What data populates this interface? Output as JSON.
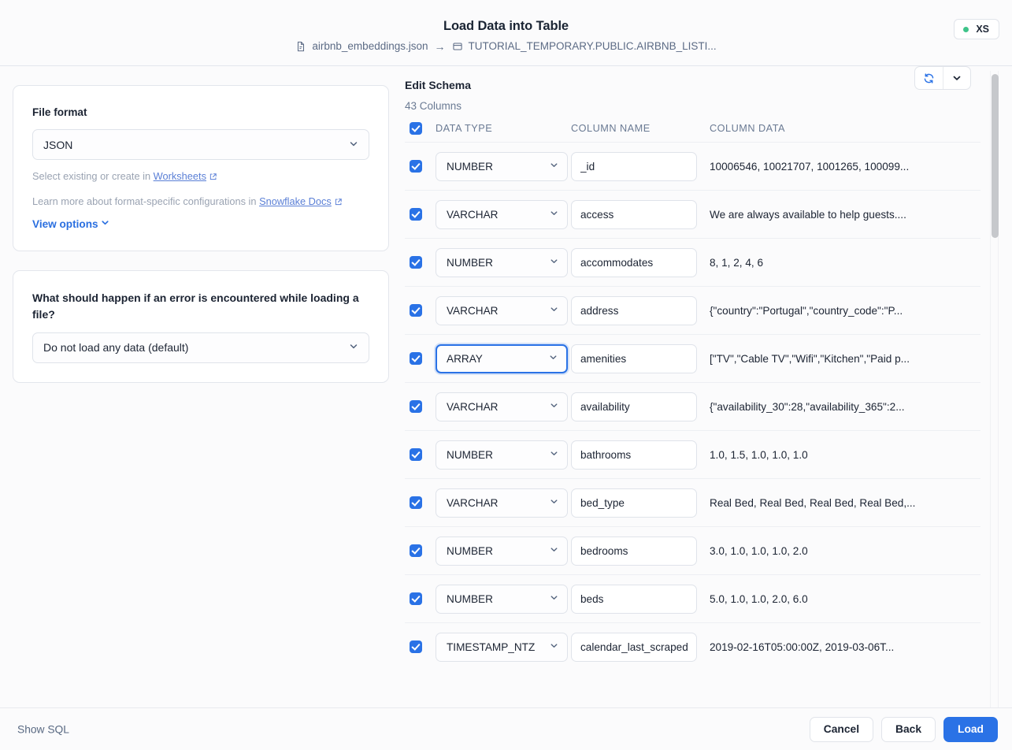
{
  "header": {
    "title": "Load Data into Table",
    "breadcrumb": {
      "source_icon": "file-icon",
      "source": "airbnb_embeddings.json",
      "arrow": "→",
      "target_icon": "table-icon",
      "target": "TUTORIAL_TEMPORARY.PUBLIC.AIRBNB_LISTI..."
    },
    "warehouse_badge": {
      "label": "XS",
      "status_color": "#3fc48a"
    }
  },
  "left_panel": {
    "file_format_card": {
      "label": "File format",
      "select_value": "JSON",
      "hint_1_prefix": "Select existing or create in ",
      "hint_1_link": "Worksheets",
      "hint_2_prefix": "Learn more about format-specific configurations in ",
      "hint_2_link": "Snowflake Docs",
      "view_options": "View options"
    },
    "error_card": {
      "question": "What should happen if an error is encountered while loading a file?",
      "select_value": "Do not load any data (default)"
    }
  },
  "schema_panel": {
    "title": "Edit Schema",
    "column_count": "43 Columns",
    "refresh_icon": "refresh-icon",
    "dropdown_icon": "chevron-down-icon",
    "headers": {
      "data_type": "DATA TYPE",
      "column_name": "COLUMN NAME",
      "column_data": "COLUMN DATA"
    },
    "rows": [
      {
        "checked": true,
        "type": "NUMBER",
        "name": "_id",
        "data": "10006546, 10021707, 1001265, 100099...",
        "focused": false
      },
      {
        "checked": true,
        "type": "VARCHAR",
        "name": "access",
        "data": "We are always available to help guests....",
        "focused": false
      },
      {
        "checked": true,
        "type": "NUMBER",
        "name": "accommodates",
        "data": "8, 1, 2, 4, 6",
        "focused": false
      },
      {
        "checked": true,
        "type": "VARCHAR",
        "name": "address",
        "data": "{\"country\":\"Portugal\",\"country_code\":\"P...",
        "focused": false
      },
      {
        "checked": true,
        "type": "ARRAY",
        "name": "amenities",
        "data": "[\"TV\",\"Cable TV\",\"Wifi\",\"Kitchen\",\"Paid p...",
        "focused": true
      },
      {
        "checked": true,
        "type": "VARCHAR",
        "name": "availability",
        "data": "{\"availability_30\":28,\"availability_365\":2...",
        "focused": false
      },
      {
        "checked": true,
        "type": "NUMBER",
        "name": "bathrooms",
        "data": "1.0, 1.5, 1.0, 1.0, 1.0",
        "focused": false
      },
      {
        "checked": true,
        "type": "VARCHAR",
        "name": "bed_type",
        "data": "Real Bed, Real Bed, Real Bed, Real Bed,...",
        "focused": false
      },
      {
        "checked": true,
        "type": "NUMBER",
        "name": "bedrooms",
        "data": "3.0, 1.0, 1.0, 1.0, 2.0",
        "focused": false
      },
      {
        "checked": true,
        "type": "NUMBER",
        "name": "beds",
        "data": "5.0, 1.0, 1.0, 2.0, 6.0",
        "focused": false
      },
      {
        "checked": true,
        "type": "TIMESTAMP_NTZ",
        "name": "calendar_last_scraped",
        "data": "2019-02-16T05:00:00Z, 2019-03-06T...",
        "focused": false
      }
    ]
  },
  "footer": {
    "show_sql": "Show SQL",
    "cancel": "Cancel",
    "back": "Back",
    "load": "Load"
  },
  "colors": {
    "accent": "#2a72e6",
    "link": "#5a7fd6",
    "status_green": "#3fc48a",
    "page_bg": "#fbfbfc"
  }
}
